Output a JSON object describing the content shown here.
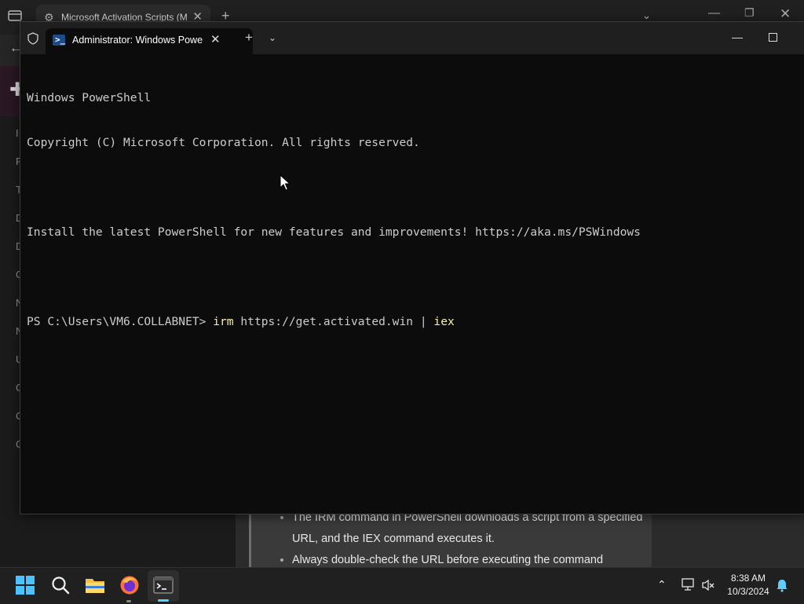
{
  "browser": {
    "tab_title": "Microsoft Activation Scripts (M",
    "new_tab_label": "+",
    "sidebar_initials": [
      "I",
      "F",
      "T",
      "D",
      "D",
      "C",
      "N",
      "N",
      "U",
      "C",
      "C",
      "C"
    ],
    "article_bullets": [
      "The IRM command in PowerShell downloads a script from a specified URL, and the IEX command executes it.",
      "Always double-check the URL before executing the command"
    ]
  },
  "terminal": {
    "tab_title": "Administrator: Windows Powe",
    "new_tab_label": "+",
    "lines": [
      "Windows PowerShell",
      "Copyright (C) Microsoft Corporation. All rights reserved.",
      "",
      "Install the latest PowerShell for new features and improvements! https://aka.ms/PSWindows",
      ""
    ],
    "prompt": "PS C:\\Users\\VM6.COLLABNET> ",
    "command": {
      "cmd1": "irm",
      "arg": " https://get.activated.win | ",
      "cmd2": "iex"
    }
  },
  "taskbar": {
    "apps": [
      "start-icon",
      "search-icon",
      "file-explorer-icon",
      "firefox-icon",
      "terminal-icon"
    ],
    "clock": {
      "time": "8:38 AM",
      "date": "10/3/2024"
    },
    "accent_color": "#60cdff"
  }
}
